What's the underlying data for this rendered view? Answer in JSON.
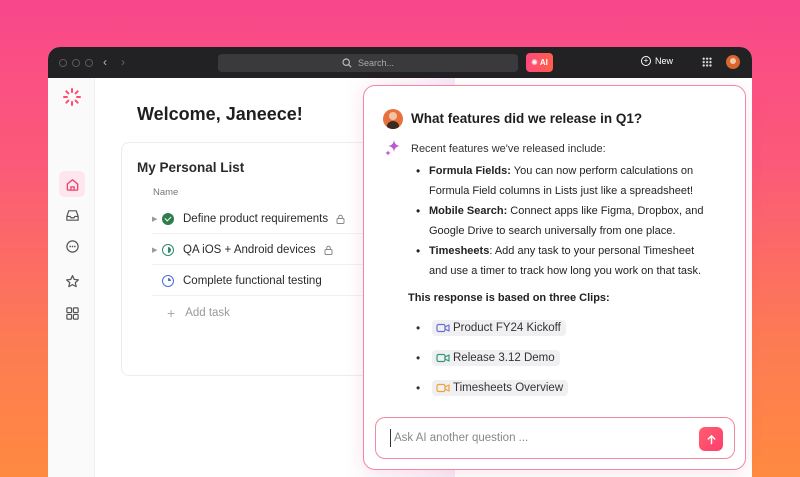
{
  "topbar": {
    "search_placeholder": "Search...",
    "ai_label": "AI",
    "new_label": "New"
  },
  "sidebar": {
    "items": [
      {
        "name": "home",
        "icon": "home-icon",
        "active": true
      },
      {
        "name": "inbox",
        "icon": "inbox-icon",
        "active": false
      },
      {
        "name": "chat",
        "icon": "chat-icon",
        "active": false
      },
      {
        "name": "favorites",
        "icon": "star-icon",
        "active": false
      },
      {
        "name": "spaces",
        "icon": "apps-icon",
        "active": false
      }
    ]
  },
  "main": {
    "welcome": "Welcome, Janeece!",
    "list_title": "My Personal List",
    "column_name": "Name",
    "tasks": [
      {
        "label": "Define product requirements",
        "status": "done",
        "locked": true
      },
      {
        "label": "QA iOS + Android devices",
        "status": "in-progress",
        "locked": true
      },
      {
        "label": "Complete functional testing",
        "status": "todo",
        "locked": false
      }
    ],
    "add_task": "Add task"
  },
  "ai_panel": {
    "question": "What features did we release in Q1?",
    "intro": "Recent features we've released include:",
    "features": [
      {
        "title": "Formula Fields:",
        "line1": " You can now perform calculations on",
        "line2": "Formula Field columns in Lists just like a spreadsheet!"
      },
      {
        "title": "Mobile Search:",
        "line1": " Connect apps like Figma, Dropbox, and",
        "line2": "Google Drive to search universally from one place."
      },
      {
        "title": "Timesheets",
        "line1": ": Add any task to your personal Timesheet",
        "line2": "and use a timer to track how long you work on that task."
      }
    ],
    "based_on": "This response is based on three Clips:",
    "clips": [
      {
        "label": "Product FY24 Kickoff",
        "color": "#6b6fd8"
      },
      {
        "label": "Release 3.12 Demo",
        "color": "#2f9a7a"
      },
      {
        "label": "Timesheets Overview",
        "color": "#f0a23a"
      }
    ],
    "ask_placeholder": "Ask AI another question ..."
  },
  "colors": {
    "accent": "#ff4a7a",
    "topbar": "#222124"
  }
}
